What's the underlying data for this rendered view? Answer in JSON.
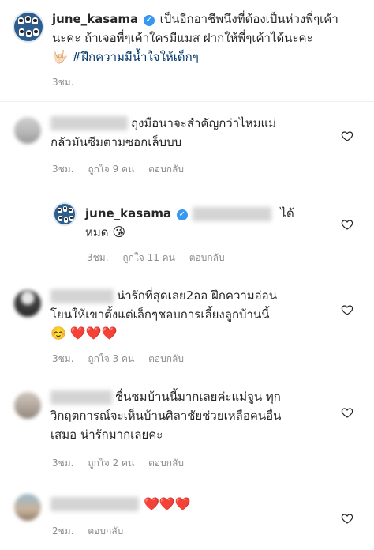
{
  "post": {
    "username": "june_kasama",
    "caption_line1": "เป็นอีกอาชีพนึงที่ต้องเป็นห่วงพี่ๆเค้า",
    "caption_line2": "นะคะ ถ้าเจอพี่ๆเค้าใครมีแมส ฝากให้พี่ๆเค้าได้นะคะ",
    "caption_emoji": "🤟🏻",
    "hashtag": "#ฝึกความมีน้ำใจให้เด็กๆ",
    "time": "3ชม."
  },
  "comments": [
    {
      "text_line1": "ถุงมือนาจะสำคัญกว่าไหมแม่",
      "text_line2": "กลัวมันซึมตามซอกเล็บบบ",
      "time": "3ชม.",
      "likes": "ถูกใจ 9 คน",
      "reply": "ตอบกลับ"
    },
    {
      "username": "june_kasama",
      "text_suffix": "ได้",
      "text_line2": "หมด",
      "emoji": "😘",
      "time": "3ชม.",
      "likes": "ถูกใจ 11 คน",
      "reply": "ตอบกลับ"
    },
    {
      "text_line1": "น่ารักที่สุดเลย2ออ ฝึกความอ่อน",
      "text_line2": "โยนให้เขาตั้งแต่เล็กๆชอบการเลี้ยงลูกบ้านนี้",
      "emoji_smile": "☺️",
      "emoji_hearts": "❤️❤️❤️",
      "time": "3ชม.",
      "likes": "ถูกใจ 3 คน",
      "reply": "ตอบกลับ"
    },
    {
      "text_line1": "ชื่นชมบ้านนี้มากเลยค่ะแม่จูน ทุก",
      "text_line2": "วิกฤตการณ์จะเห็นบ้านศิลาชัยช่วยเหลือคนอื่น",
      "text_line3": "เสมอ น่ารักมากเลยค่ะ",
      "time": "3ชม.",
      "likes": "ถูกใจ 2 คน",
      "reply": "ตอบกลับ"
    },
    {
      "emoji_hearts": "❤️❤️❤️",
      "time": "2ชม.",
      "reply": "ตอบกลับ"
    }
  ],
  "icons": {
    "verified": "verified-badge-icon",
    "like": "heart-outline-icon"
  },
  "colors": {
    "text": "#262626",
    "meta": "#8e8e8e",
    "hashtag": "#00376b",
    "verified": "#3897f0"
  }
}
